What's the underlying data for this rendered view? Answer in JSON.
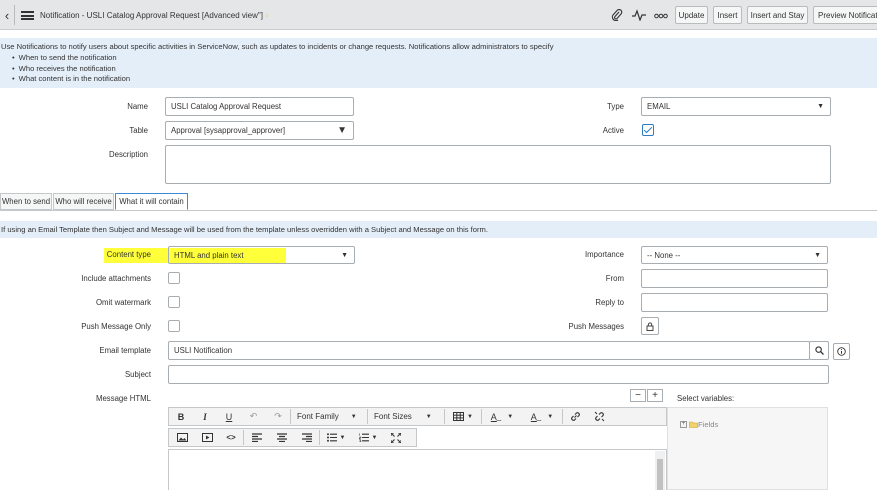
{
  "header": {
    "title": "Notification - USLI Catalog Approval Request",
    "view": "[Advanced view\"]",
    "buttons": {
      "update": "Update",
      "insert": "Insert",
      "insert_and_stay": "Insert and Stay",
      "preview": "Preview Notificatio"
    }
  },
  "banner": {
    "intro": "Use Notifications to notify users about specific activities in ServiceNow, such as updates to incidents or change requests. Notifications allow administrators to specify",
    "bullets": [
      "When to send the notification",
      "Who receives the notification",
      "What content is in the notification"
    ]
  },
  "form": {
    "name_label": "Name",
    "name_value": "USLI Catalog Approval Request",
    "table_label": "Table",
    "table_value": "Approval [sysapproval_approver]",
    "description_label": "Description",
    "type_label": "Type",
    "type_value": "EMAIL",
    "active_label": "Active"
  },
  "tabs": [
    "When to send",
    "Who will receive",
    "What it will contain"
  ],
  "tab_banner": "If using an Email Template then Subject and Message will be used from the template unless overridden with a Subject and Message on this form.",
  "content": {
    "content_type_label": "Content type",
    "content_type_value": "HTML and plain text",
    "include_attachments_label": "Include attachments",
    "omit_watermark_label": "Omit watermark",
    "push_message_only_label": "Push Message Only",
    "email_template_label": "Email template",
    "email_template_value": "USLI Notification",
    "subject_label": "Subject",
    "message_html_label": "Message HTML",
    "importance_label": "Importance",
    "importance_value": "-- None --",
    "from_label": "From",
    "reply_to_label": "Reply to",
    "push_messages_label": "Push Messages"
  },
  "editor": {
    "font_family": "Font Family",
    "font_sizes": "Font Sizes",
    "minus": "−",
    "plus": "+"
  },
  "variables": {
    "title": "Select variables:",
    "fields": "Fields"
  },
  "colors": {
    "highlight": "#ffff3a",
    "accent": "#2f7dc0",
    "banner": "#e4eef8"
  }
}
